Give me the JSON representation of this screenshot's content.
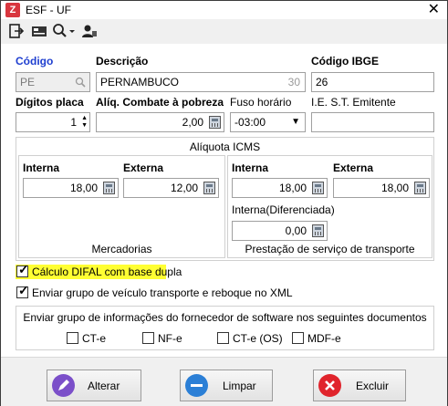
{
  "window": {
    "title": "ESF - UF",
    "app_icon": "Z"
  },
  "toolbar": {
    "icons": [
      "exit-icon",
      "card-icon",
      "search-dropdown-icon",
      "user-icon"
    ]
  },
  "form": {
    "codigo_label": "Código",
    "codigo_value": "PE",
    "descricao_label": "Descrição",
    "descricao_value": "PERNAMBUCO",
    "descricao_maxlen": "30",
    "codigo_ibge_label": "Código IBGE",
    "codigo_ibge_value": "26",
    "digitos_placa_label": "Dígitos placa",
    "digitos_placa_value": "1",
    "aliq_combate_label": "Alíq. Combate à pobreza",
    "aliq_combate_value": "2,00",
    "fuso_label": "Fuso horário",
    "fuso_value": "-03:00",
    "ie_st_label": "I.E. S.T.  Emitente",
    "ie_st_value": ""
  },
  "icms": {
    "title": "Alíquota ICMS",
    "mercadorias": {
      "title": "Mercadorias",
      "interna_label": "Interna",
      "interna_value": "18,00",
      "externa_label": "Externa",
      "externa_value": "12,00"
    },
    "transporte": {
      "title": "Prestação de serviço de transporte",
      "interna_label": "Interna",
      "interna_value": "18,00",
      "externa_label": "Externa",
      "externa_value": "18,00",
      "interna_dif_label": "Interna(Diferenciada)",
      "interna_dif_value": "0,00"
    }
  },
  "options": {
    "difal_label": "Cálculo DIFAL com base dupla",
    "difal_checked": true,
    "veiculo_label": "Enviar grupo de veículo transporte e reboque no XML",
    "veiculo_checked": true
  },
  "software_group": {
    "title": "Enviar grupo de informações do fornecedor de software nos seguintes documentos",
    "items": [
      {
        "label": "CT-e",
        "checked": false
      },
      {
        "label": "NF-e",
        "checked": false
      },
      {
        "label": "CT-e (OS)",
        "checked": false
      },
      {
        "label": "MDF-e",
        "checked": false
      }
    ]
  },
  "buttons": {
    "alterar": "Alterar",
    "limpar": "Limpar",
    "excluir": "Excluir"
  },
  "colors": {
    "accent_blue": "#1f3fd0",
    "highlight": "#ffff33",
    "alterar_icon": "#7b4fc9",
    "limpar_icon": "#2b7fd6",
    "excluir_icon": "#e0242c"
  }
}
